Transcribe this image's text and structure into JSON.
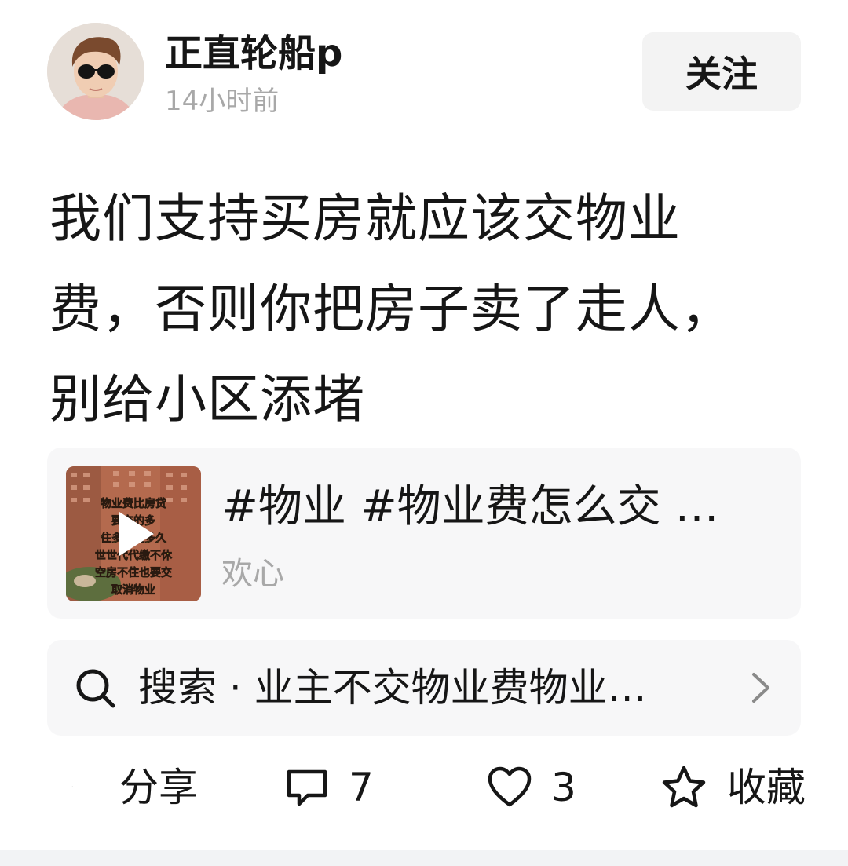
{
  "header": {
    "author_name": "正直轮船p",
    "post_time": "14小时前",
    "follow_label": "关注"
  },
  "post": {
    "line1": "我们支持买房就应该交物业",
    "line2": "费，否则你把房子卖了走人，",
    "line3": "别给小区添堵"
  },
  "video_card": {
    "title": "#物业 #物业费怎么交 …",
    "author": "欢心",
    "thumbnail_caption": [
      "物业费比房贷",
      "要交的多",
      "住多久交多久",
      "世世代代缴不休",
      "空房不住也要交",
      "取消物业"
    ]
  },
  "search": {
    "text": "搜索 · 业主不交物业费物业…"
  },
  "actions": {
    "share_label": "分享",
    "comment_count": "7",
    "like_count": "3",
    "favorite_label": "收藏"
  },
  "icons": {
    "search": "search-icon",
    "chevron": "chevron-right-icon",
    "comment": "comment-icon",
    "like": "heart-icon",
    "favorite": "star-icon",
    "play": "play-icon"
  }
}
